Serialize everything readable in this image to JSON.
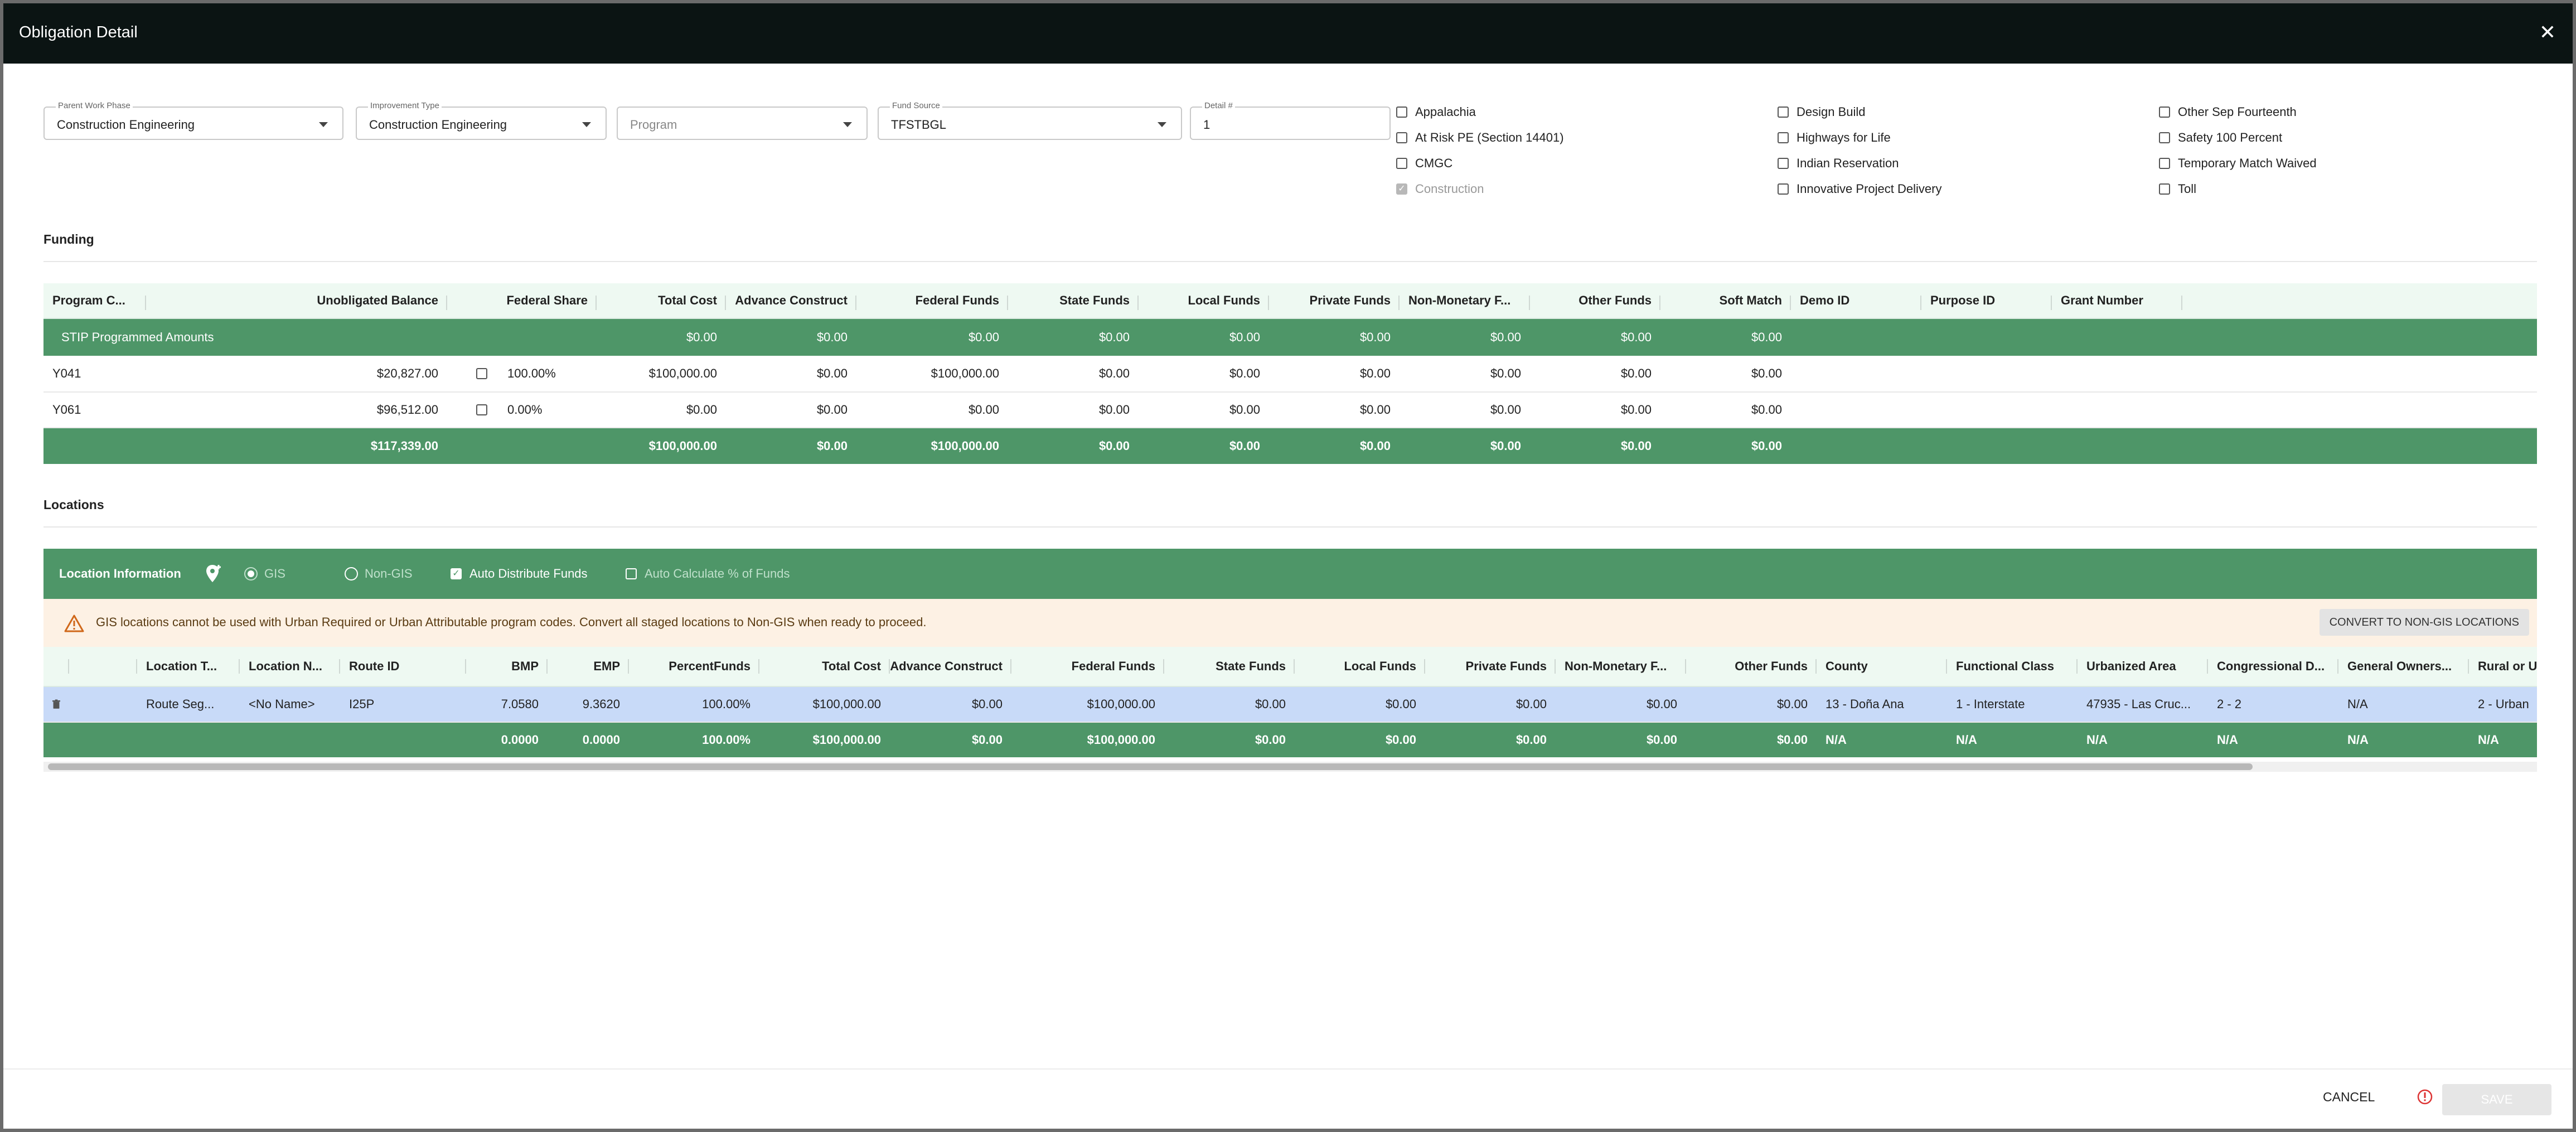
{
  "dialog": {
    "title": "Obligation Detail",
    "close_glyph": "✕"
  },
  "fields": {
    "parent_work_phase": {
      "label": "Parent Work Phase",
      "value": "Construction Engineering"
    },
    "improvement_type": {
      "label": "Improvement Type",
      "value": "Construction Engineering"
    },
    "program": {
      "placeholder": "Program"
    },
    "fund_source": {
      "label": "Fund Source",
      "value": "TFSTBGL"
    },
    "detail_number": {
      "label": "Detail #",
      "value": "1"
    }
  },
  "checkboxes": [
    {
      "label": "Appalachia",
      "checked": false,
      "disabled": false
    },
    {
      "label": "At Risk PE (Section 14401)",
      "checked": false,
      "disabled": false
    },
    {
      "label": "CMGC",
      "checked": false,
      "disabled": false
    },
    {
      "label": "Construction",
      "checked": true,
      "disabled": true
    },
    {
      "label": "Design Build",
      "checked": false,
      "disabled": false
    },
    {
      "label": "Highways for Life",
      "checked": false,
      "disabled": false
    },
    {
      "label": "Indian Reservation",
      "checked": false,
      "disabled": false
    },
    {
      "label": "Innovative Project Delivery",
      "checked": false,
      "disabled": false
    },
    {
      "label": "Other Sep Fourteenth",
      "checked": false,
      "disabled": false
    },
    {
      "label": "Safety 100 Percent",
      "checked": false,
      "disabled": false
    },
    {
      "label": "Temporary Match Waived",
      "checked": false,
      "disabled": false
    },
    {
      "label": "Toll",
      "checked": false,
      "disabled": false
    }
  ],
  "funding": {
    "title": "Funding",
    "headers": [
      "Program C...",
      "Unobligated Balance",
      "Federal Share",
      "Total Cost",
      "Advance Construct",
      "Federal Funds",
      "State Funds",
      "Local Funds",
      "Private Funds",
      "Non-Monetary F...",
      "Other Funds",
      "Soft Match",
      "Demo ID",
      "Purpose ID",
      "Grant Number"
    ],
    "stip": {
      "label": "STIP Programmed Amounts",
      "total_cost": "$0.00",
      "advance_construction": "$0.00",
      "federal_funds": "$0.00",
      "state_funds": "$0.00",
      "local_funds": "$0.00",
      "private_funds": "$0.00",
      "non_monetary": "$0.00",
      "other_funds": "$0.00",
      "soft_match": "$0.00"
    },
    "rows": [
      {
        "program_code": "Y041",
        "unobligated_balance": "$20,827.00",
        "federal_share": "100.00%",
        "total_cost": "$100,000.00",
        "advance_construction": "$0.00",
        "federal_funds": "$100,000.00",
        "state_funds": "$0.00",
        "local_funds": "$0.00",
        "private_funds": "$0.00",
        "non_monetary": "$0.00",
        "other_funds": "$0.00",
        "soft_match": "$0.00"
      },
      {
        "program_code": "Y061",
        "unobligated_balance": "$96,512.00",
        "federal_share": "0.00%",
        "total_cost": "$0.00",
        "advance_construction": "$0.00",
        "federal_funds": "$0.00",
        "state_funds": "$0.00",
        "local_funds": "$0.00",
        "private_funds": "$0.00",
        "non_monetary": "$0.00",
        "other_funds": "$0.00",
        "soft_match": "$0.00"
      }
    ],
    "totals": {
      "unobligated_balance": "$117,339.00",
      "total_cost": "$100,000.00",
      "advance_construction": "$0.00",
      "federal_funds": "$100,000.00",
      "state_funds": "$0.00",
      "local_funds": "$0.00",
      "private_funds": "$0.00",
      "non_monetary": "$0.00",
      "other_funds": "$0.00",
      "soft_match": "$0.00"
    }
  },
  "locations": {
    "title": "Locations",
    "toolbar": {
      "label": "Location Information",
      "gis": "GIS",
      "non_gis": "Non-GIS",
      "auto_distribute": "Auto Distribute Funds",
      "auto_calculate": "Auto Calculate % of Funds"
    },
    "warning": "GIS locations cannot be used with Urban Required or Urban Attributable program codes. Convert all staged locations to Non-GIS when ready to proceed.",
    "convert_button": "CONVERT TO NON-GIS LOCATIONS",
    "headers": {
      "location_type": "Location T...",
      "location_name": "Location N...",
      "route_id": "Route ID",
      "bmp": "BMP",
      "emp": "EMP",
      "percent_funds_1": "Percent",
      "percent_funds_2": "Funds",
      "total_cost": "Total Cost",
      "advance_construction": "Advance Construct",
      "federal_funds": "Federal Funds",
      "state_funds": "State Funds",
      "local_funds": "Local Funds",
      "private_funds": "Private Funds",
      "non_monetary": "Non-Monetary F...",
      "other_funds": "Other Funds",
      "county": "County",
      "functional_class": "Functional Class",
      "urbanized_area": "Urbanized Area",
      "congressional": "Congressional D...",
      "general_ownership": "General Owners...",
      "rural_urban": "Rural or Urb"
    },
    "row": {
      "location_type": "Route Seg...",
      "location_name": "<No Name>",
      "route_id": "I25P",
      "bmp": "7.0580",
      "emp": "9.3620",
      "percent_funds": "100.00%",
      "total_cost": "$100,000.00",
      "advance_construction": "$0.00",
      "federal_funds": "$100,000.00",
      "state_funds": "$0.00",
      "local_funds": "$0.00",
      "private_funds": "$0.00",
      "non_monetary": "$0.00",
      "other_funds": "$0.00",
      "county": "13 - Doña Ana",
      "functional_class": "1 - Interstate",
      "urbanized_area": "47935 - Las Cruc...",
      "congressional": "2 - 2",
      "general_ownership": "N/A",
      "rural_urban": "2 - Urban"
    },
    "totals": {
      "bmp": "0.0000",
      "emp": "0.0000",
      "percent_funds": "100.00%",
      "total_cost": "$100,000.00",
      "advance_construction": "$0.00",
      "federal_funds": "$100,000.00",
      "state_funds": "$0.00",
      "local_funds": "$0.00",
      "private_funds": "$0.00",
      "non_monetary": "$0.00",
      "other_funds": "$0.00",
      "county": "N/A",
      "functional_class": "N/A",
      "urbanized_area": "N/A",
      "congressional": "N/A",
      "general_ownership": "N/A",
      "rural_urban": "N/A"
    }
  },
  "footer": {
    "cancel": "CANCEL",
    "save": "SAVE"
  },
  "colors": {
    "title_bar": "#0b1413",
    "accent_green": "#4e9668",
    "header_tint": "#eef9f2",
    "warning_bg": "#fdf1e4",
    "selected_row": "#c8daf8"
  }
}
